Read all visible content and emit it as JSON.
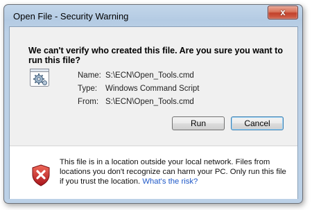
{
  "window": {
    "title": "Open File - Security Warning",
    "close_glyph": "x"
  },
  "dialog": {
    "question": "We can't verify who created this file. Are you sure you want to run this file?",
    "file_icon": "script-file-gear-icon",
    "fields": [
      {
        "label": "Name:",
        "value": "S:\\ECN\\Open_Tools.cmd"
      },
      {
        "label": "Type:",
        "value": "Windows Command Script"
      },
      {
        "label": "From:",
        "value": "S:\\ECN\\Open_Tools.cmd"
      }
    ],
    "buttons": {
      "run": "Run",
      "cancel": "Cancel"
    }
  },
  "warning": {
    "icon": "red-shield-x-icon",
    "text": "This file is in a location outside your local network. Files from locations you don't recognize can harm your PC. Only run this file if you trust the location.",
    "link": "What's the risk?"
  },
  "colors": {
    "titlebar": "#bcd1e7",
    "close_button": "#c2412b",
    "link": "#1e58c8",
    "shield": "#c8252b"
  }
}
